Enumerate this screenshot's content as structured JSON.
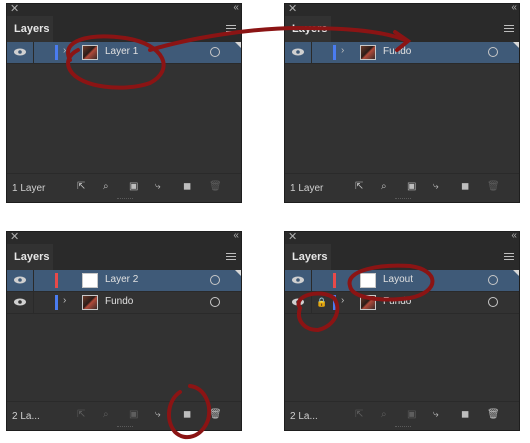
{
  "panels": [
    {
      "tab": "Layers",
      "count": "1 Layer",
      "layers": [
        {
          "name": "Layer 1",
          "thumb": "image",
          "color": "#4a7cf0",
          "selected": true,
          "expand": true,
          "locked": false
        }
      ]
    },
    {
      "tab": "Layers",
      "count": "1 Layer",
      "layers": [
        {
          "name": "Fundo",
          "thumb": "image",
          "color": "#4a7cf0",
          "selected": true,
          "expand": true,
          "locked": false
        }
      ]
    },
    {
      "tab": "Layers",
      "count": "2 La...",
      "layers": [
        {
          "name": "Layer 2",
          "thumb": "white",
          "color": "#e84a4a",
          "selected": true,
          "expand": false,
          "locked": false
        },
        {
          "name": "Fundo",
          "thumb": "image",
          "color": "#4a7cf0",
          "selected": false,
          "expand": true,
          "locked": false
        }
      ]
    },
    {
      "tab": "Layers",
      "count": "2 La...",
      "layers": [
        {
          "name": "Layout",
          "thumb": "white",
          "color": "#e84a4a",
          "selected": true,
          "expand": false,
          "locked": false
        },
        {
          "name": "Fundo",
          "thumb": "image",
          "color": "#4a7cf0",
          "selected": false,
          "expand": true,
          "locked": true
        }
      ]
    }
  ],
  "icons": {
    "close": "close-icon",
    "collapse": "double-chevron-icon",
    "menu": "panel-menu-icon",
    "visibility": "eye-icon",
    "lock": "lock-icon",
    "target": "target-circle-icon",
    "export": "export-icon",
    "locate": "locate-object-icon",
    "clipping": "clipping-mask-icon",
    "sublayer": "new-sublayer-icon",
    "newlayer": "new-layer-icon",
    "delete": "trash-icon"
  },
  "annotation_color": "#8b1414"
}
